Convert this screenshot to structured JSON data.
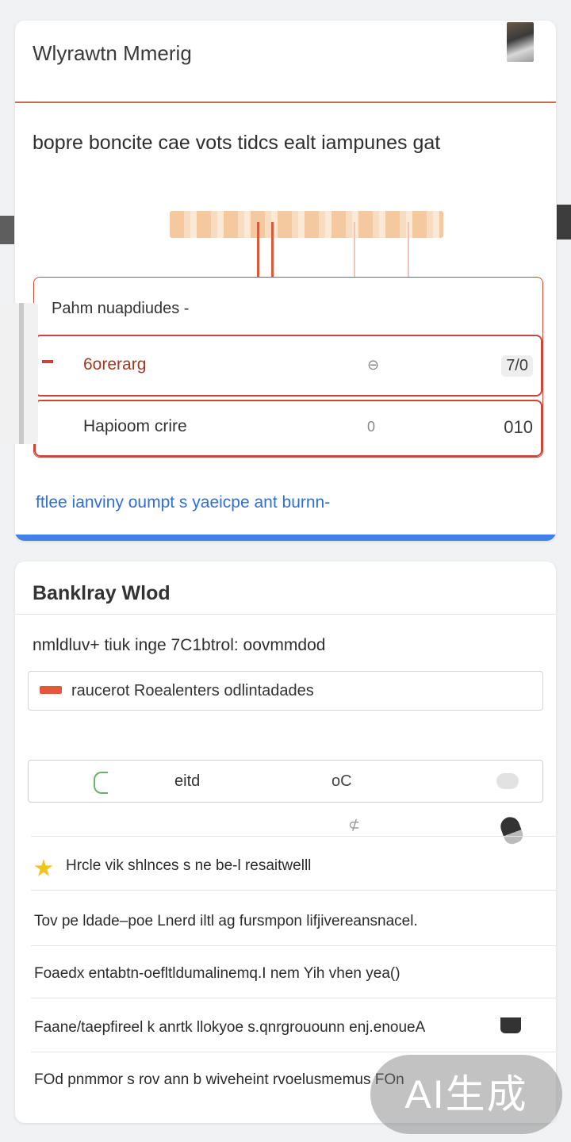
{
  "card1": {
    "title": "Wlyrawtn Mmerig",
    "subtitle": "bopre boncite cae vots tidcs ealt iampunes gat",
    "pending": {
      "label": "Pahm nuapdiudes -",
      "rows": [
        {
          "name": "6orerarg",
          "mid": "⊖",
          "value": "7/0"
        },
        {
          "name": "Hapioom crire",
          "mid": "0",
          "value": "010"
        }
      ]
    },
    "link_text": "ftlee ianviny oumpt s  yaeicpe ant burnn-"
  },
  "card2": {
    "title": "Banklray Wlod",
    "description": "nmldluv+ tiuk inge 7C1btrol: oovmmdod",
    "info_text": "raucerot Roealenters odlintadades",
    "options": {
      "label": "eitd",
      "mid": "oC"
    },
    "tiny_mark": "⊄",
    "items": [
      "Hrcle vik shlnces s ne be-l resaitwelll",
      "Tov pe ldade–poe Lnerd iltl ag fursmpon lifjivereansnacel.",
      "Foaedx entabtn-oefltldumalinemq.I nem Yih vhen yea()",
      "Faane/taepfireel k anrtk llokyoe s.qnrgrouounn enj.enoueA",
      "FOd pnmmor s rov ann b wiveheint rvoelusmemus FOn"
    ]
  },
  "watermark": "AI生成",
  "colors": {
    "accent_red": "#c9463a",
    "link_blue": "#2f6fd6",
    "bar_blue": "#3f82e8",
    "background": "#f1f2f4"
  }
}
